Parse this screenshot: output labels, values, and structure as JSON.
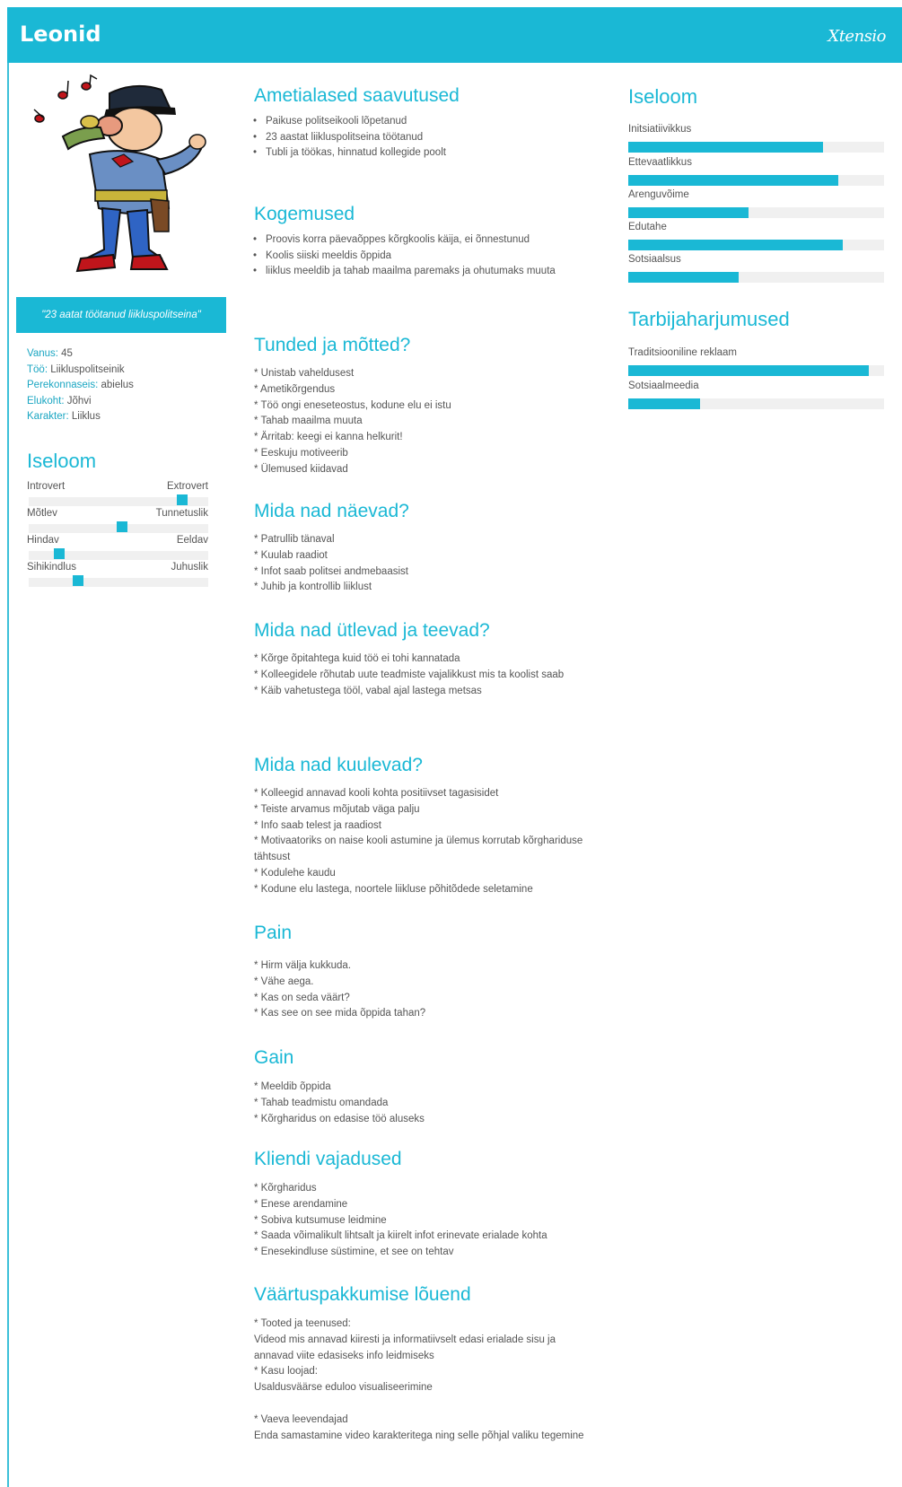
{
  "header": {
    "name": "Leonid",
    "logo": "Xtensio"
  },
  "colors": {
    "accent": "#1ab8d5",
    "track": "#f0f0f0"
  },
  "avatar": {
    "icon": "cartoon-policeman-whistling-icon"
  },
  "quote": "\"23 aatat töötanud liikluspolitseina\"",
  "facts": [
    {
      "key": "Vanus:",
      "value": " 45"
    },
    {
      "key": "Töö:",
      "value": " Liikluspolitseinik"
    },
    {
      "key": "Perekonnaseis:",
      "value": " abielus"
    },
    {
      "key": "Elukoht:",
      "value": " Jõhvi"
    },
    {
      "key": "Karakter:",
      "value": " Liiklus"
    }
  ],
  "left_personality": {
    "title": "Iseloom",
    "sliders": [
      {
        "left": "Introvert",
        "right": "Extrovert",
        "value": 0.88
      },
      {
        "left": "Mõtlev",
        "right": "Tunnetuslik",
        "value": 0.52
      },
      {
        "left": "Hindav",
        "right": "Eeldav",
        "value": 0.15
      },
      {
        "left": "Sihikindlus",
        "right": "Juhuslik",
        "value": 0.26
      }
    ]
  },
  "sections": {
    "achievements": {
      "title": "Ametialased saavutused",
      "items": [
        "Paikuse politseikooli lõpetanud",
        "23 aastat liikluspolitseina töötanud",
        "Tubli ja töökas, hinnatud kollegide poolt"
      ]
    },
    "experience": {
      "title": "Kogemused",
      "items": [
        "Proovis korra päevaõppes kõrgkoolis käija, ei õnnestunud",
        "Koolis siiski meeldis õppida",
        "liiklus meeldib ja tahab maailma paremaks ja ohutumaks muuta"
      ]
    },
    "feelings": {
      "title": "Tunded ja mõtted?",
      "lines": [
        "* Unistab vaheldusest",
        "* Ametikõrgendus",
        "* Töö ongi eneseteostus, kodune elu ei istu",
        "* Tahab maailma muuta",
        "* Ärritab: keegi ei kanna helkurit!",
        "* Eeskuju motiveerib",
        "* Ülemused kiidavad"
      ]
    },
    "see": {
      "title": "Mida nad näevad?",
      "lines": [
        "* Patrullib tänaval",
        "* Kuulab raadiot",
        "* Infot saab politsei andmebaasist",
        "* Juhib ja kontrollib liiklust"
      ]
    },
    "say": {
      "title": "Mida nad ütlevad ja teevad?",
      "lines": [
        "* Kõrge õpitahtega kuid töö ei tohi kannatada",
        "* Kolleegidele rõhutab uute teadmiste vajalikkust mis ta koolist saab",
        "* Käib vahetustega tööl, vabal ajal lastega metsas"
      ]
    },
    "hear": {
      "title": "Mida nad kuulevad?",
      "lines": [
        "* Kolleegid annavad kooli kohta positiivset tagasisidet",
        "* Teiste arvamus mõjutab väga palju",
        "* Info saab telest ja raadiost",
        "* Motivaatoriks on naise kooli astumine ja ülemus korrutab kõrghariduse tähtsust",
        "* Kodulehe kaudu",
        "* Kodune elu lastega, noortele liikluse põhitõdede seletamine"
      ]
    },
    "pain": {
      "title": "Pain",
      "lines": [
        "* Hirm välja kukkuda.",
        "* Vähe aega.",
        "* Kas on seda väärt?",
        "* Kas see on see mida õppida tahan?"
      ]
    },
    "gain": {
      "title": "Gain",
      "lines": [
        "* Meeldib õppida",
        "* Tahab teadmistu omandada",
        "* Kõrgharidus on edasise töö aluseks"
      ]
    },
    "needs": {
      "title": "Kliendi vajadused",
      "lines": [
        "* Kõrgharidus",
        "* Enese arendamine",
        "* Sobiva kutsumuse leidmine",
        "* Saada võimalikult lihtsalt ja kiirelt infot erinevate erialade kohta",
        "* Enesekindluse süstimine, et see on tehtav"
      ]
    },
    "value": {
      "title": "Väärtuspakkumise lõuend",
      "lines": [
        "* Tooted ja teenused:",
        "Videod mis annavad kiiresti ja informatiivselt edasi erialade sisu ja annavad viite edasiseks info leidmiseks",
        "* Kasu loojad:",
        "Usaldusväärse eduloo visualiseerimine",
        "",
        "* Vaeva leevendajad",
        "Enda samastamine video karakteritega ning selle põhjal valiku tegemine"
      ]
    }
  },
  "right_personality": {
    "title": "Iseloom",
    "bars": [
      {
        "label": "Initsiatiivikkus",
        "value": 0.76
      },
      {
        "label": "Ettevaatlikkus",
        "value": 0.82
      },
      {
        "label": "Arenguvõime",
        "value": 0.47
      },
      {
        "label": "Edutahe",
        "value": 0.84
      },
      {
        "label": "Sotsiaalsus",
        "value": 0.43
      }
    ]
  },
  "consumption": {
    "title": "Tarbijaharjumused",
    "bars": [
      {
        "label": "Traditsiooniline reklaam",
        "value": 0.94
      },
      {
        "label": "Sotsiaalmeedia",
        "value": 0.28
      }
    ]
  }
}
